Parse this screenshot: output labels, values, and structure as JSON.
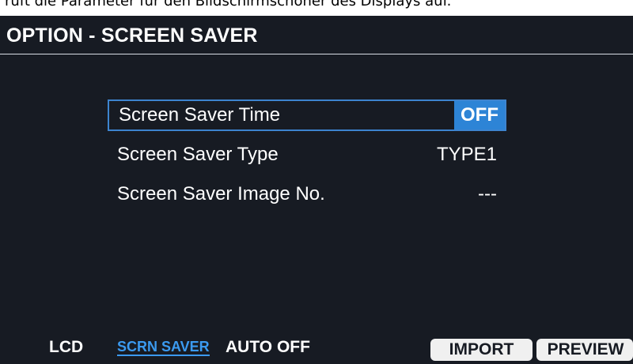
{
  "caption": {
    "text": "ruft die Parameter für den Bildschirmschoner des Displays auf."
  },
  "screen": {
    "title": "OPTION - SCREEN SAVER",
    "parameters": [
      {
        "label": "Screen Saver Time",
        "value": "OFF",
        "selected": true
      },
      {
        "label": "Screen Saver Type",
        "value": "TYPE1",
        "selected": false
      },
      {
        "label": "Screen Saver Image No.",
        "value": "---",
        "selected": false
      }
    ],
    "tabs": [
      {
        "label": "LCD",
        "active": false
      },
      {
        "label": "SCRN SAVER",
        "active": true
      },
      {
        "label": "AUTO OFF",
        "active": false
      }
    ],
    "buttons": {
      "import": "IMPORT",
      "preview": "PREVIEW"
    }
  },
  "colors": {
    "screen_background": "#171b23",
    "selection": "#2d84d6",
    "active_tab": "#3b9af0",
    "button_background": "#f0f0f0"
  }
}
